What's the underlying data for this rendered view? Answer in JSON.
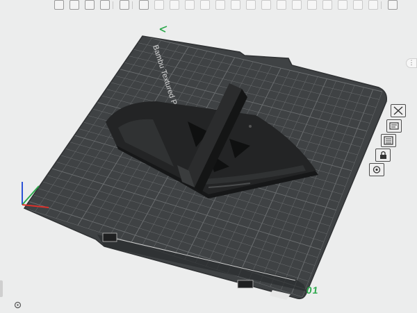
{
  "plate": {
    "name": "Bambu Textured PEI Plate",
    "number": "01"
  },
  "toolbar": {
    "groups": [
      [
        "add-object",
        "add-plate",
        "auto-orient",
        "arrange"
      ],
      [
        "more"
      ],
      [
        "move",
        "rotate",
        "scale",
        "cut",
        "split",
        "lay-on-face",
        "support-paint",
        "seam-paint",
        "color-paint",
        "text",
        "measure",
        "assembly",
        "boolean",
        "variable-layer",
        "simplify",
        "emboss"
      ],
      [
        "slice-settings"
      ]
    ]
  },
  "side_buttons": [
    "close-view-icon",
    "plate-layers-icon",
    "object-list-icon",
    "lock-icon",
    "settings-gear-icon"
  ],
  "colors": {
    "background": "#eceded",
    "plate": "#3f4244",
    "grid": "#6d7072",
    "model": "#1d1e1f",
    "accent_green": "#2aa84a",
    "axis_x": "#d9322c",
    "axis_y": "#2aa84a",
    "axis_z": "#2c52d6"
  }
}
